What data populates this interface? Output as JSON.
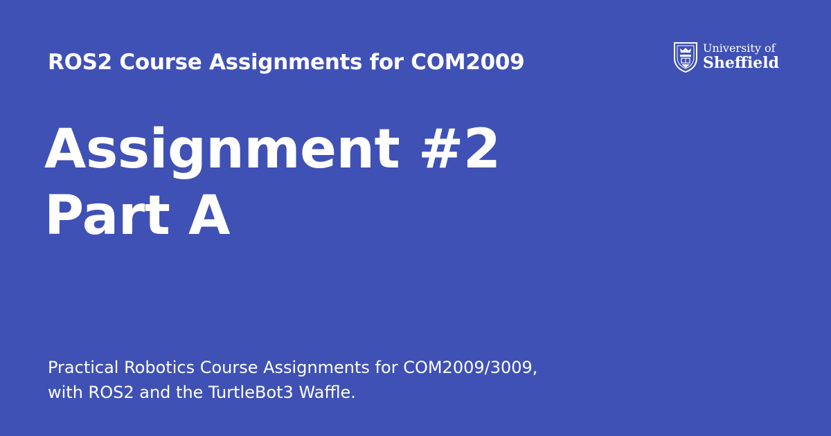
{
  "site_name": "ROS2 Course Assignments for COM2009",
  "page_title": {
    "line1": "Assignment #2",
    "line2": "Part A"
  },
  "description": {
    "line1": "Practical Robotics Course Assignments for COM2009/3009,",
    "line2": "with ROS2 and the TurtleBot3 Waffle."
  },
  "logo": {
    "line1": "University of",
    "line2": "Sheffield",
    "icon": "university-crest-icon"
  },
  "colors": {
    "background": "#3f51b5",
    "text": "#ffffff"
  }
}
